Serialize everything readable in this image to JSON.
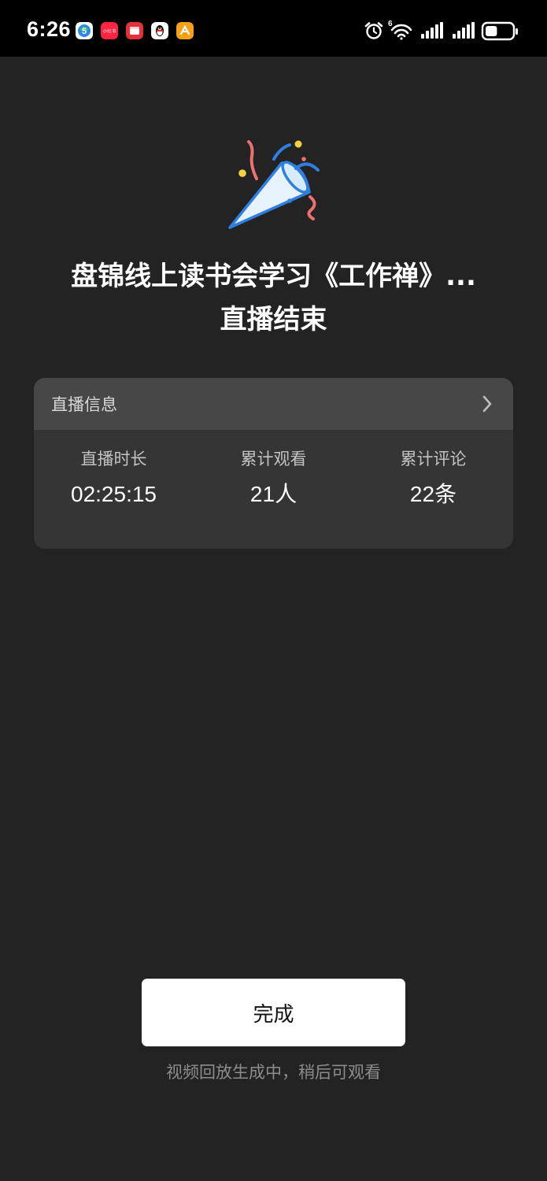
{
  "status_bar": {
    "time": "6:26",
    "app_icons": [
      "5g-app-icon",
      "xiaohongshu-icon",
      "red-app-icon",
      "qq-icon",
      "orange-app-icon"
    ],
    "app_badge_text": "小红书",
    "right_icons": [
      "alarm-icon",
      "wifi-icon",
      "signal-icon",
      "signal-icon",
      "battery-icon"
    ],
    "wifi_label": "6",
    "battery_level": 0.45
  },
  "hero": {
    "icon": "party-popper-icon",
    "title_line1": "盘锦线上读书会学习《工作禅》...",
    "title_line2": "直播结束"
  },
  "info_card": {
    "header_label": "直播信息",
    "stats": [
      {
        "label": "直播时长",
        "value": "02:25:15"
      },
      {
        "label": "累计观看",
        "value": "21人"
      },
      {
        "label": "累计评论",
        "value": "22条"
      }
    ]
  },
  "footer": {
    "done_label": "完成",
    "note": "视频回放生成中，稍后可观看"
  },
  "colors": {
    "background": "#232323",
    "card": "#353535",
    "card_header": "#474747",
    "button": "#ffffff"
  }
}
